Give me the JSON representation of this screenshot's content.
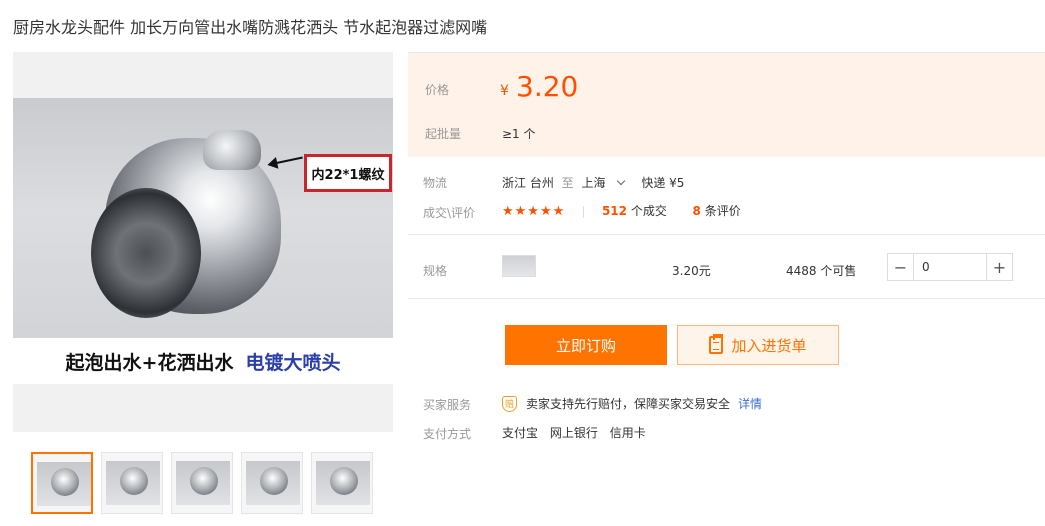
{
  "title": "厨房水龙头配件 加长万向管出水嘴防溅花洒头 节水起泡器过滤网嘴",
  "image": {
    "banner_left": "起泡出水+花洒出水",
    "banner_right": "电镀大喷头",
    "spec_tag": "内22*1螺纹"
  },
  "price_box": {
    "price_label": "价格",
    "currency": "¥",
    "price": "3.20",
    "moq_label": "起批量",
    "moq_value": "≥1 个"
  },
  "logistics": {
    "label": "物流",
    "from": "浙江 台州",
    "to_word": "至",
    "to": "上海",
    "express": "快递 ¥5"
  },
  "deal": {
    "label": "成交\\评价",
    "stars": "★★★★★",
    "deals_count": "512",
    "deals_suffix": "个成交",
    "reviews_count": "8",
    "reviews_suffix": "条评价"
  },
  "spec": {
    "label": "规格",
    "sku_price": "3.20元",
    "stock": "4488 个可售",
    "quantity": "0",
    "minus": "−",
    "plus": "+"
  },
  "actions": {
    "buy_now": "立即订购",
    "add_to_list": "加入进货单"
  },
  "service": {
    "label": "买家服务",
    "badge": "赔",
    "text": "卖家支持先行赔付，保障买家交易安全",
    "details_link": "详情"
  },
  "payment": {
    "label": "支付方式",
    "methods": [
      "支付宝",
      "网上银行",
      "信用卡"
    ]
  },
  "colors": {
    "accent": "#ff7300",
    "price": "#ff5000",
    "link": "#3a6ed6"
  }
}
